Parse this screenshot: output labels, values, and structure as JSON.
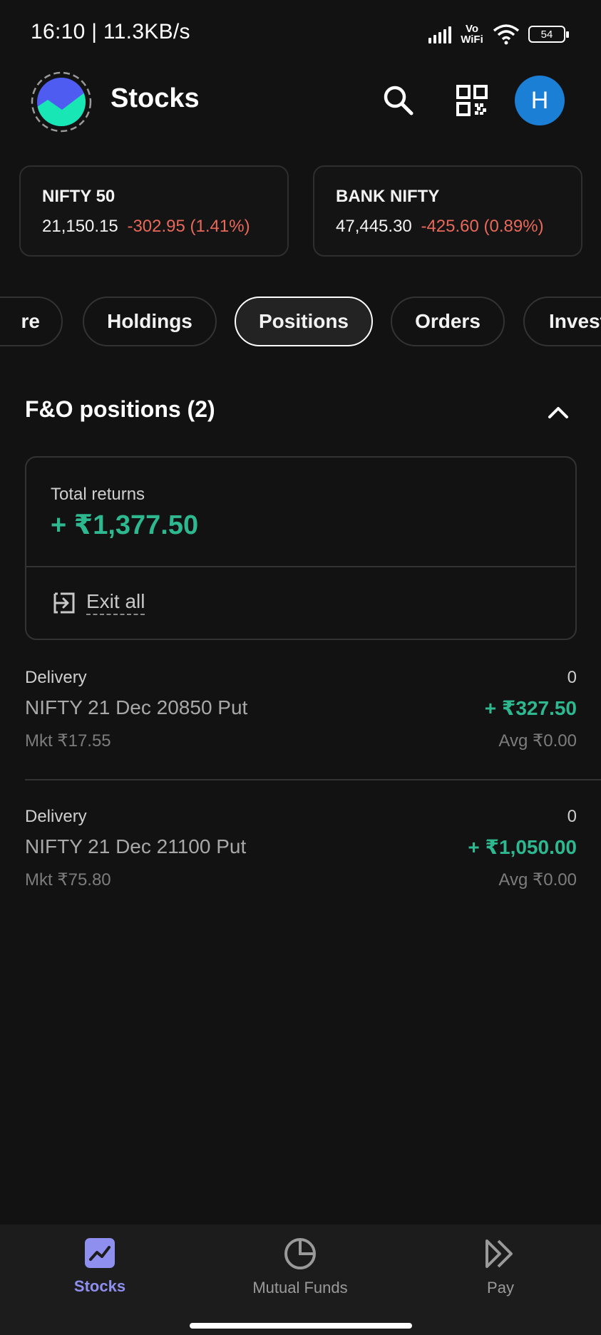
{
  "status_bar": {
    "time": "16:10 | 11.3KB/s",
    "network": "Vo WiFi",
    "battery": "54",
    "icons": [
      "signal-icon",
      "vowifi-icon",
      "wifi-icon",
      "battery-icon"
    ]
  },
  "header": {
    "title": "Stocks",
    "avatar_initial": "H",
    "icons": [
      "app-logo-icon",
      "search-icon",
      "qr-code-icon"
    ]
  },
  "indices": [
    {
      "name": "NIFTY 50",
      "value": "21,150.15",
      "change": "-302.95 (1.41%)"
    },
    {
      "name": "BANK NIFTY",
      "value": "47,445.30",
      "change": "-425.60 (0.89%)"
    }
  ],
  "tabs": [
    {
      "label": "Explore",
      "visible_text": "re"
    },
    {
      "label": "Holdings",
      "visible_text": "Holdings"
    },
    {
      "label": "Positions",
      "visible_text": "Positions",
      "active": true
    },
    {
      "label": "Orders",
      "visible_text": "Orders"
    },
    {
      "label": "Investments",
      "visible_text": "Invest"
    }
  ],
  "section": {
    "title": "F&O positions (2)",
    "collapse_icon": "chevron-up-icon"
  },
  "returns": {
    "label": "Total returns",
    "value": "+ ₹1,377.50",
    "exit_label": "Exit all",
    "exit_icon": "exit-icon"
  },
  "positions": [
    {
      "type": "Delivery",
      "qty": "0",
      "name": "NIFTY 21 Dec 20850 Put",
      "pnl": "+ ₹327.50",
      "mkt": "Mkt ₹17.55",
      "avg": "Avg ₹0.00"
    },
    {
      "type": "Delivery",
      "qty": "0",
      "name": "NIFTY 21 Dec 21100 Put",
      "pnl": "+ ₹1,050.00",
      "mkt": "Mkt ₹75.80",
      "avg": "Avg ₹0.00"
    }
  ],
  "bottom_nav": [
    {
      "label": "Stocks",
      "icon": "stocks-chart-icon",
      "active": true
    },
    {
      "label": "Mutual Funds",
      "icon": "pie-chart-icon"
    },
    {
      "label": "Pay",
      "icon": "pay-forward-icon"
    }
  ],
  "colors": {
    "background": "#121212",
    "positive": "#2db890",
    "negative": "#e8685a",
    "accent": "#8f8ff0",
    "avatar": "#1b7fd6"
  }
}
